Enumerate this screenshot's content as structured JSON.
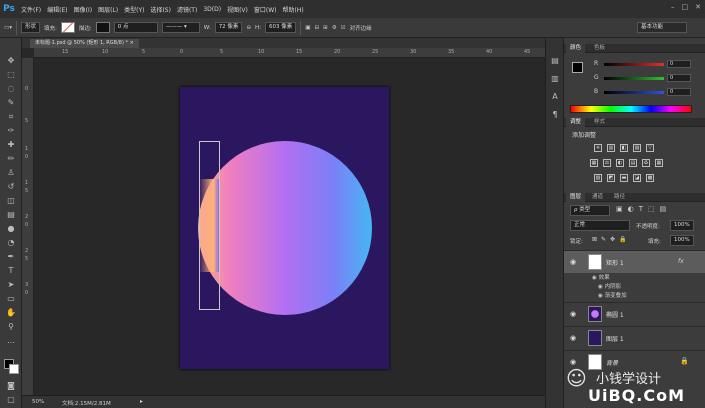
{
  "app": {
    "logo": "Ps"
  },
  "menu": [
    "文件(F)",
    "编辑(E)",
    "图像(I)",
    "图层(L)",
    "类型(Y)",
    "选择(S)",
    "滤镜(T)",
    "3D(D)",
    "视图(V)",
    "窗口(W)",
    "帮助(H)"
  ],
  "window_controls": [
    "–",
    "□",
    "✕"
  ],
  "options_bar": {
    "shape_mode": "形状",
    "fill_label": "填充:",
    "stroke_label": "描边:",
    "stroke_width": "0 点",
    "w_label": "W:",
    "w_value": "72 像素",
    "h_label": "H:",
    "h_value": "603 像素",
    "align_edges": "对齐边缘",
    "workspace": "基本功能"
  },
  "document": {
    "tab_title": "未标题-1.psd @ 50% (矩形 1, RGB/8) * ×",
    "zoom": "50%",
    "doc_size": "文档:2.15M/2.81M",
    "artboard_color": "#2a1760"
  },
  "rulers": {
    "top": [
      "15",
      "10",
      "5",
      "0",
      "5",
      "10",
      "15",
      "20",
      "25",
      "30",
      "35",
      "40",
      "45"
    ],
    "left": [
      "0",
      "5",
      "1",
      "0",
      "1",
      "5",
      "2",
      "0",
      "2",
      "5",
      "3",
      "0"
    ]
  },
  "color_panel": {
    "tabs": [
      "颜色",
      "色板"
    ],
    "channels": [
      {
        "label": "R",
        "value": "0",
        "color": "#e03030"
      },
      {
        "label": "G",
        "value": "0",
        "color": "#30c030"
      },
      {
        "label": "B",
        "value": "0",
        "color": "#3050e0"
      }
    ]
  },
  "adjustments_panel": {
    "tabs": [
      "调整",
      "样式"
    ],
    "heading": "添加调整",
    "row1": [
      "☀",
      "▥",
      "◧",
      "▨",
      "▽"
    ],
    "row2": [
      "▦",
      "⚖",
      "◐",
      "▤",
      "♻",
      "▦"
    ],
    "row3": [
      "▧",
      "◩",
      "▬",
      "◪",
      "▩"
    ]
  },
  "layers_panel": {
    "tabs": [
      "图层",
      "通道",
      "路径"
    ],
    "filter_type": "ρ 类型",
    "blend_mode": "正常",
    "opacity_label": "不透明度:",
    "opacity_value": "100%",
    "lock_label": "锁定:",
    "fill_label": "填充:",
    "fill_value": "100%",
    "layers": [
      {
        "name": "矩形 1",
        "fx": "fx",
        "selected": true
      },
      {
        "name": "椭圆 1",
        "selected": false
      },
      {
        "name": "图层 1",
        "selected": false
      },
      {
        "name": "背景",
        "selected": false
      }
    ],
    "effects": {
      "label": "效果",
      "items": [
        "内阴影",
        "渐变叠加"
      ]
    }
  },
  "watermark": {
    "icon": "☺",
    "line1": "小钱学设计",
    "line2": "UiBQ.CoM"
  }
}
